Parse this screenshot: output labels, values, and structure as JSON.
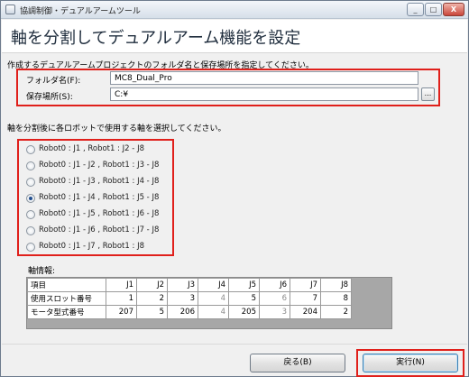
{
  "window": {
    "title": "協調制御・デュアルアームツール",
    "minimize_icon": "_",
    "maximize_icon": "□",
    "close_icon": "X"
  },
  "header": {
    "title": "軸を分割してデュアルアーム機能を設定"
  },
  "project": {
    "instruction": "作成するデュアルアームプロジェクトのフォルダ名と保存場所を指定してください。",
    "folder_label": "フォルダ名(F):",
    "folder_value": "MC8_Dual_Pro",
    "location_label": "保存場所(S):",
    "location_value": "C:¥",
    "browse_label": "..."
  },
  "axes": {
    "instruction": "軸を分割後に各ロボットで使用する軸を選択してください。",
    "selected_index": 3,
    "options": [
      "Robot0 : J1 , Robot1 : J2 - J8",
      "Robot0 : J1 - J2 , Robot1 : J3 - J8",
      "Robot0 : J1 - J3 , Robot1 : J4 - J8",
      "Robot0 : J1 - J4 , Robot1 : J5 - J8",
      "Robot0 : J1 - J5 , Robot1 : J6 - J8",
      "Robot0 : J1 - J6 , Robot1 : J7 - J8",
      "Robot0 : J1 - J7 , Robot1 : J8"
    ]
  },
  "axis_info": {
    "caption": "軸情報:",
    "header": [
      "項目",
      "J1",
      "J2",
      "J3",
      "J4",
      "J5",
      "J6",
      "J7",
      "J8"
    ],
    "rows": [
      [
        "使用スロット番号",
        "1",
        "2",
        "3",
        "4",
        "5",
        "6",
        "7",
        "8"
      ],
      [
        "モータ型式番号",
        "207",
        "5",
        "206",
        "4",
        "205",
        "3",
        "204",
        "2"
      ]
    ]
  },
  "footer": {
    "back_label": "戻る(B)",
    "execute_label": "実行(N)"
  }
}
